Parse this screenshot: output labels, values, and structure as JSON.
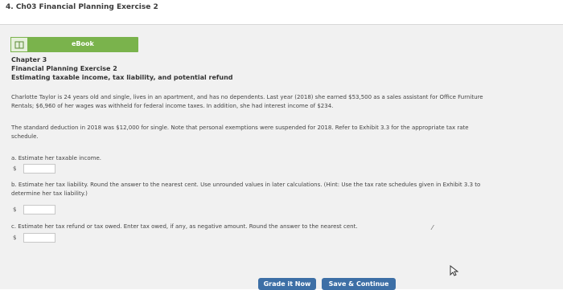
{
  "page_title": "4. Ch03 Financial Planning Exercise 2",
  "ebook": {
    "label": "eBook",
    "icon": "book-icon"
  },
  "header": {
    "chapter": "Chapter 3",
    "exercise": "Financial Planning Exercise 2",
    "subtitle": "Estimating taxable income, tax liability, and potential refund"
  },
  "paragraphs": {
    "p1_line1": "Charlotte Taylor is 24 years old and single, lives in an apartment, and has no dependents. Last year (2018) she earned $53,500 as a sales assistant for Office Furniture",
    "p1_line2": "Rentals; $6,960 of her wages was withheld for federal income taxes. In addition, she had interest income of $234.",
    "p2_line1": "The standard deduction in 2018 was $12,000 for single. Note that personal exemptions were suspended for 2018. Refer to Exhibit 3.3 for the appropriate tax rate",
    "p2_line2": "schedule."
  },
  "questions": {
    "a": {
      "text": "a. Estimate her taxable income.",
      "currency": "$",
      "value": ""
    },
    "b": {
      "line1": "b. Estimate her tax liability. Round the answer to the nearest cent. Use unrounded values in later calculations. (Hint: Use the tax rate schedules given in Exhibit 3.3 to",
      "line2": "determine her tax liability.)",
      "currency": "$",
      "value": ""
    },
    "c": {
      "text": "c. Estimate her tax refund or tax owed. Enter tax owed, if any, as negative amount. Round the answer to the nearest cent.",
      "currency": "$",
      "value": ""
    }
  },
  "buttons": {
    "grade": "Grade it Now",
    "save": "Save & Continue"
  },
  "colors": {
    "ebook_green": "#7ab34c",
    "button_blue": "#3d6fa6",
    "panel_bg": "#f1f1f1"
  }
}
